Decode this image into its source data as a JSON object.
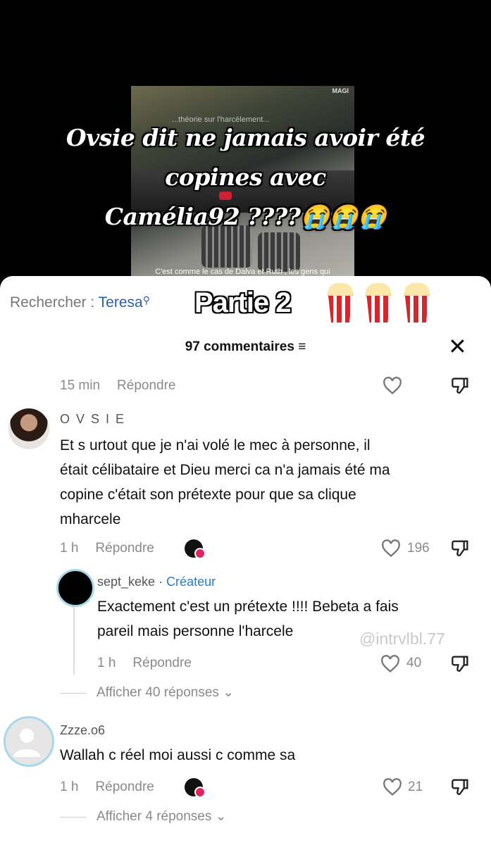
{
  "video": {
    "headline_lines": [
      "Ovsie dit ne jamais avoir été",
      "copines avec",
      "Camélia92 ????😭😭😭"
    ],
    "subtitle": "C'est comme le cas de Dalva et Ruth , les gens qui",
    "overlay_top": "...théorie sur l'harcèlement...",
    "sign_text": "MAGI"
  },
  "search": {
    "label": "Rechercher : ",
    "query": "Teresa",
    "icon": "search-icon"
  },
  "overlay_title": "Partie 2",
  "comments_header": {
    "count_label": "97 commentaires",
    "filter_icon": "≡",
    "close_icon": "✕"
  },
  "top_row": {
    "time": "15 min",
    "reply": "Répondre"
  },
  "comments": [
    {
      "username": "O V S I E",
      "text_lines": [
        "Et s urtout que je n'ai volé le mec à personne, il",
        "était célibataire et Dieu merci ca n'a jamais été ma",
        "copine c'était son prétexte pour que sa clique",
        "mharcele"
      ],
      "time": "1 h",
      "reply": "Répondre",
      "likes": "196"
    },
    {
      "username": "sept_keke",
      "separator": " · ",
      "badge": "Créateur",
      "text_lines": [
        "Exactement c'est un prétexte !!!! Bebeta a fais",
        "pareil mais personne l'harcele"
      ],
      "time": "1 h",
      "reply": "Répondre",
      "likes": "40"
    },
    {
      "username": "Zzze.o6",
      "text_lines": [
        "Wallah c réel moi aussi c comme sa"
      ],
      "time": "1 h",
      "reply": "Répondre",
      "likes": "21"
    }
  ],
  "show_more": [
    "Afficher 40 réponses",
    "Afficher 4 réponses"
  ],
  "watermark": "@intrvlbl.77",
  "colors": {
    "link_blue": "#2b5fb3",
    "creator_blue": "#2b7bbf",
    "heart_badge": "#e0245e"
  }
}
